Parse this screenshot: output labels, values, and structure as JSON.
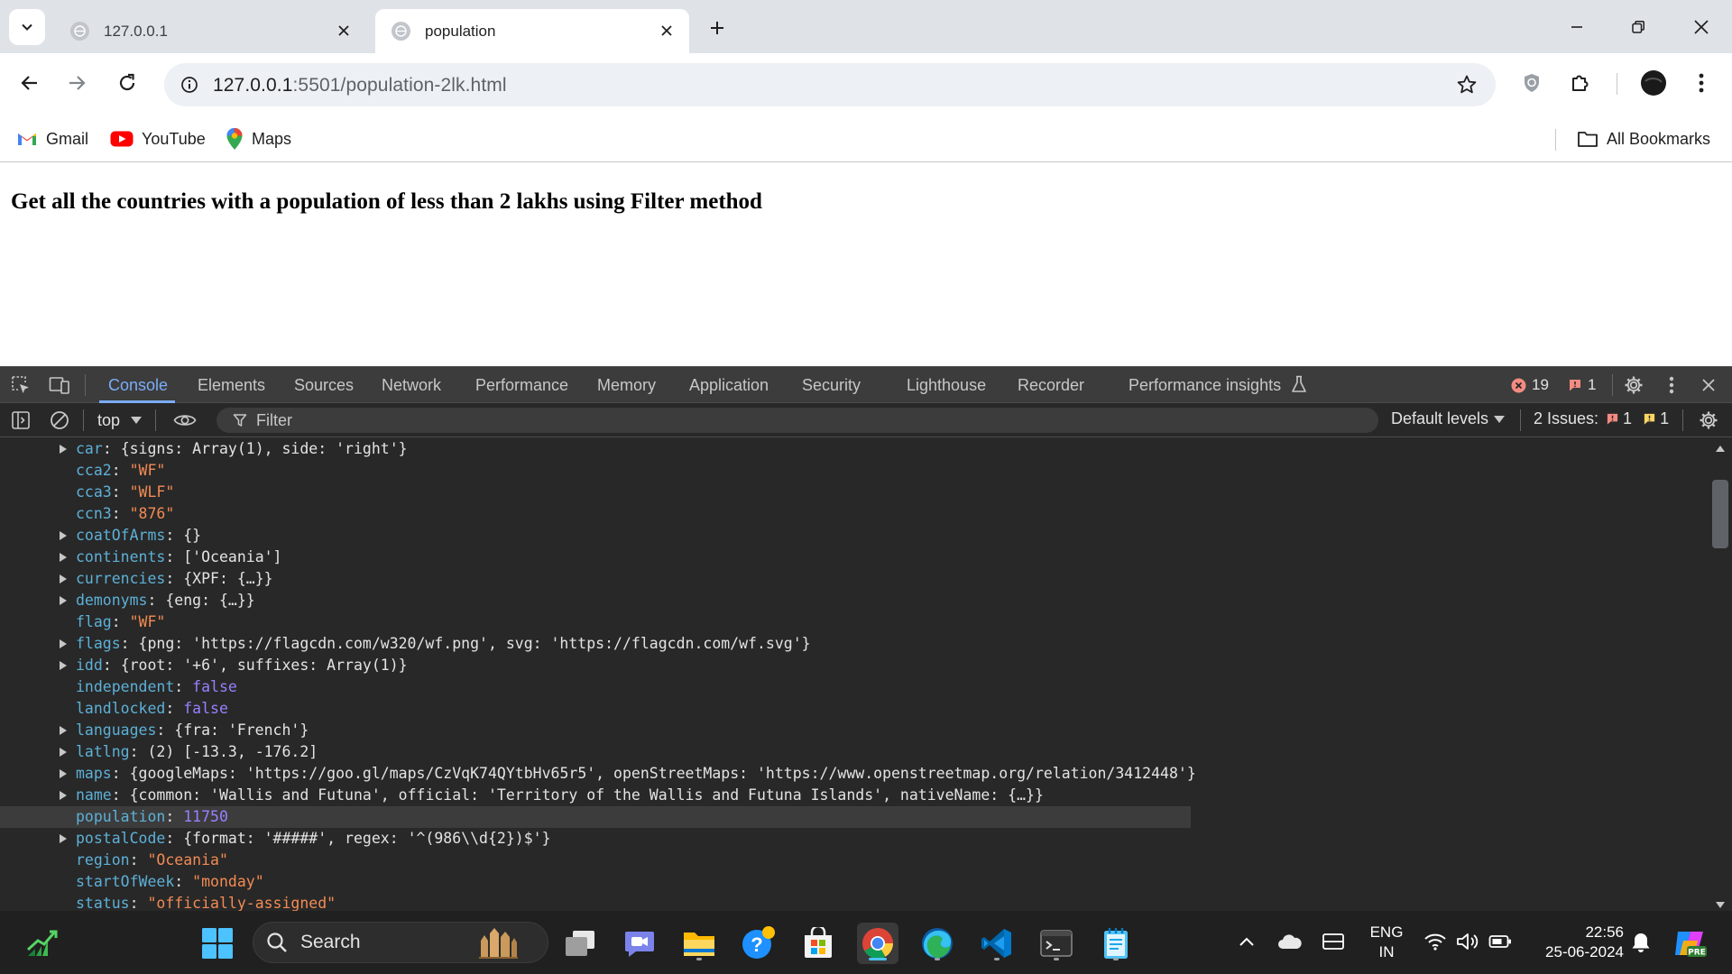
{
  "browser": {
    "tabs": [
      {
        "title": "127.0.0.1",
        "active": false
      },
      {
        "title": "population",
        "active": true
      }
    ],
    "url_host": "127.0.0.1",
    "url_path": ":5501/population-2lk.html",
    "bookmarks": [
      {
        "label": "Gmail",
        "icon": "gmail-icon"
      },
      {
        "label": "YouTube",
        "icon": "youtube-icon"
      },
      {
        "label": "Maps",
        "icon": "maps-icon"
      }
    ],
    "all_bookmarks_label": "All Bookmarks"
  },
  "page": {
    "heading": "Get all the countries with a population of less than 2 lakhs using Filter method"
  },
  "devtools": {
    "tabs": [
      "Console",
      "Elements",
      "Sources",
      "Network",
      "Performance",
      "Memory",
      "Application",
      "Security",
      "Lighthouse",
      "Recorder",
      "Performance insights"
    ],
    "active_tab": "Console",
    "error_count": "19",
    "warning_count": "1",
    "context": "top",
    "filter_placeholder": "Filter",
    "levels_label": "Default levels",
    "issues_label": "2 Issues:",
    "issues_error": "1",
    "issues_warning": "1",
    "colors": {
      "accent": "#7cacf8",
      "error": "#f28b82",
      "background": "#282828"
    },
    "console_lines": [
      {
        "expandable": true,
        "key": "car",
        "value": "{signs: Array(1), side: 'right'}"
      },
      {
        "expandable": false,
        "key": "cca2",
        "value": "\"WF\""
      },
      {
        "expandable": false,
        "key": "cca3",
        "value": "\"WLF\""
      },
      {
        "expandable": false,
        "key": "ccn3",
        "value": "\"876\""
      },
      {
        "expandable": true,
        "key": "coatOfArms",
        "value": "{}"
      },
      {
        "expandable": true,
        "key": "continents",
        "value": "['Oceania']"
      },
      {
        "expandable": true,
        "key": "currencies",
        "value": "{XPF: {…}}"
      },
      {
        "expandable": true,
        "key": "demonyms",
        "value": "{eng: {…}}"
      },
      {
        "expandable": false,
        "key": "flag",
        "value": "\"WF\""
      },
      {
        "expandable": true,
        "key": "flags",
        "value": "{png: 'https://flagcdn.com/w320/wf.png', svg: 'https://flagcdn.com/wf.svg'}"
      },
      {
        "expandable": true,
        "key": "idd",
        "value": "{root: '+6', suffixes: Array(1)}"
      },
      {
        "expandable": false,
        "key": "independent",
        "value": "false"
      },
      {
        "expandable": false,
        "key": "landlocked",
        "value": "false"
      },
      {
        "expandable": true,
        "key": "languages",
        "value": "{fra: 'French'}"
      },
      {
        "expandable": true,
        "key": "latlng",
        "value": "(2) [-13.3, -176.2]"
      },
      {
        "expandable": true,
        "key": "maps",
        "value": "{googleMaps: 'https://goo.gl/maps/CzVqK74QYtbHv65r5', openStreetMaps: 'https://www.openstreetmap.org/relation/3412448'}"
      },
      {
        "expandable": true,
        "key": "name",
        "value": "{common: 'Wallis and Futuna', official: 'Territory of the Wallis and Futuna Islands', nativeName: {…}}"
      },
      {
        "expandable": false,
        "key": "population",
        "value": "11750",
        "highlight": true
      },
      {
        "expandable": true,
        "key": "postalCode",
        "value": "{format: '#####', regex: '^(986\\\\d{2})$'}"
      },
      {
        "expandable": false,
        "key": "region",
        "value": "\"Oceania\""
      },
      {
        "expandable": false,
        "key": "startOfWeek",
        "value": "\"monday\""
      },
      {
        "expandable": false,
        "key": "status",
        "value": "\"officially-assigned\""
      }
    ]
  },
  "taskbar": {
    "search_label": "Search",
    "apps": [
      "stocks-icon",
      "start-icon",
      "task-view-icon",
      "teams-chat-icon",
      "file-explorer-icon",
      "help-icon",
      "microsoft-store-icon",
      "chrome-icon",
      "edge-icon",
      "vscode-icon",
      "terminal-icon",
      "notepad-icon"
    ],
    "lang_line1": "ENG",
    "lang_line2": "IN",
    "time": "22:56",
    "date": "25-06-2024"
  }
}
